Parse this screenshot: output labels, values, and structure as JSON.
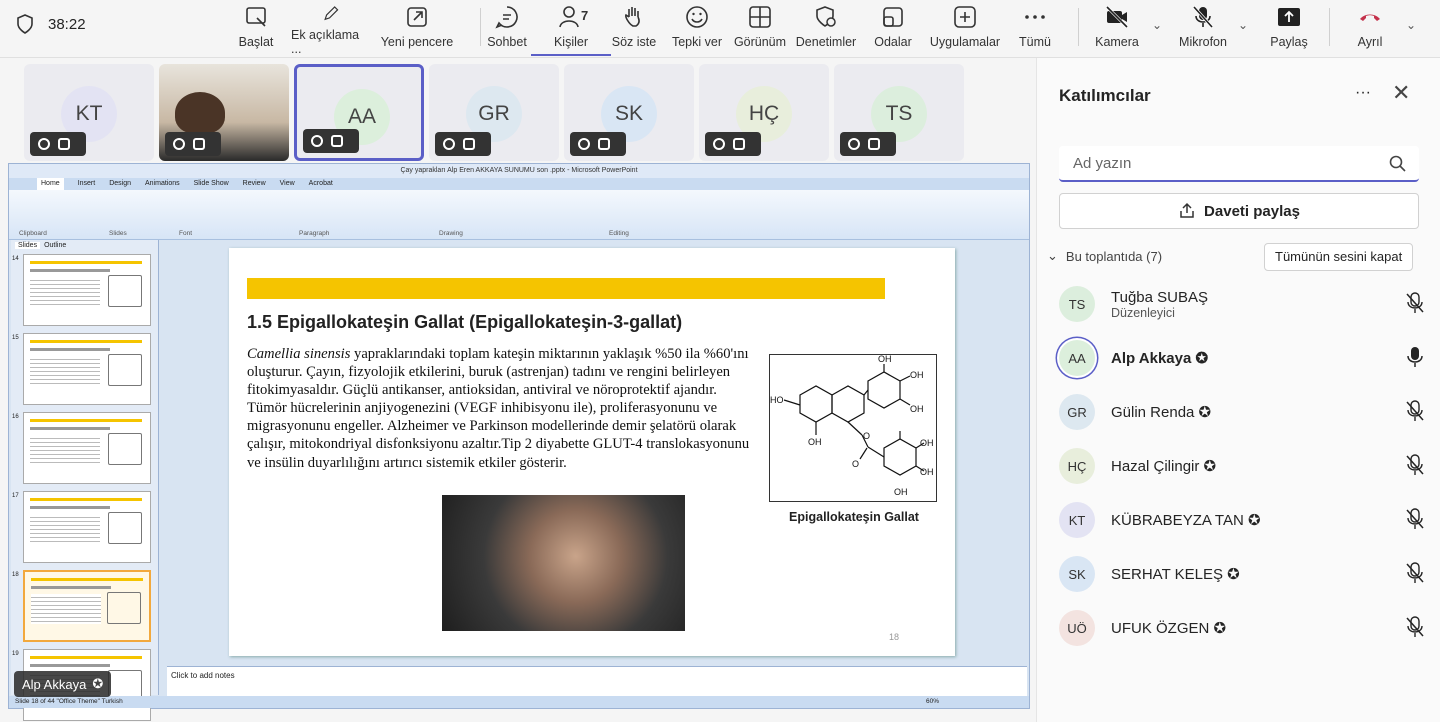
{
  "timer": "38:22",
  "toolbar": [
    {
      "id": "baslat",
      "label": "Başlat",
      "icon": "record-icon"
    },
    {
      "id": "ek",
      "label": "Ek açıklama ...",
      "icon": "pen-icon"
    },
    {
      "id": "yeni",
      "label": "Yeni pencere",
      "icon": "popout-icon"
    },
    {
      "id": "sohbet",
      "label": "Sohbet",
      "icon": "chat-icon"
    },
    {
      "id": "kisiler",
      "label": "Kişiler",
      "icon": "people-icon",
      "count": "7"
    },
    {
      "id": "soz",
      "label": "Söz iste",
      "icon": "hand-icon"
    },
    {
      "id": "tepki",
      "label": "Tepki ver",
      "icon": "emoji-icon"
    },
    {
      "id": "gorunum",
      "label": "Görünüm",
      "icon": "grid-icon"
    },
    {
      "id": "denetim",
      "label": "Denetimler",
      "icon": "shield-gear-icon"
    },
    {
      "id": "odalar",
      "label": "Odalar",
      "icon": "rooms-icon"
    },
    {
      "id": "uyg",
      "label": "Uygulamalar",
      "icon": "plus-icon"
    },
    {
      "id": "tumu",
      "label": "Tümü",
      "icon": "more-icon"
    },
    {
      "id": "kamera",
      "label": "Kamera",
      "icon": "camera-off-icon"
    },
    {
      "id": "mikrofon",
      "label": "Mikrofon",
      "icon": "mic-off-icon"
    },
    {
      "id": "paylas",
      "label": "Paylaş",
      "icon": "share-icon"
    },
    {
      "id": "ayril",
      "label": "Ayrıl",
      "icon": "hangup-icon"
    }
  ],
  "tiles": [
    {
      "initials": "KT",
      "bg": "#e3e3f3"
    },
    {
      "initials": "",
      "video": true
    },
    {
      "initials": "AA",
      "bg": "#dcefdc",
      "selected": true
    },
    {
      "initials": "GR",
      "bg": "#dde8f0"
    },
    {
      "initials": "SK",
      "bg": "#d9e6f4"
    },
    {
      "initials": "HÇ",
      "bg": "#e8eedc"
    },
    {
      "initials": "TS",
      "bg": "#dceedd"
    }
  ],
  "ppt": {
    "title": "Çay yaprakları Alp Eren AKKAYA SUNUMU son .pptx - Microsoft PowerPoint",
    "tabs": [
      "Home",
      "Insert",
      "Design",
      "Animations",
      "Slide Show",
      "Review",
      "View",
      "Acrobat"
    ],
    "groups": [
      "Clipboard",
      "Slides",
      "Font",
      "Paragraph",
      "Drawing",
      "Editing"
    ],
    "panel_tabs": [
      "Slides",
      "Outline"
    ],
    "thumb_numbers": [
      "14",
      "15",
      "16",
      "17",
      "18",
      "19"
    ],
    "notes": "Click to add notes",
    "status": "Slide 18 of 44   \"Office Theme\"   Turkish",
    "zoom": "60%"
  },
  "slide": {
    "title": "1.5 Epigallokateşin Gallat (Epigallokateşin-3-gallat)",
    "body_italic": "Camellia sinensis",
    "body": " yapraklarındaki toplam kateşin miktarının yaklaşık %50 ila %60'ını oluşturur. Çayın, fizyolojik etkilerini, buruk (astrenjan) tadını ve rengini belirleyen fitokimyasaldır. Güçlü antikanser, antioksidan, antiviral ve nöroprotektif ajandır. Tümör hücrelerinin anjiyogenezini (VEGF inhibisyonu ile), proliferasyonunu ve migrasyonunu engeller. Alzheimer ve Parkinson modellerinde demir şelatörü olarak çalışır, mitokondriyal disfonksiyonu azaltır.Tip 2 diyabette GLUT-4 translokasyonunu ve insülin duyarlılığını artırıcı sistemik etkiler gösterir.",
    "caption": "Epigallokateşin Gallat",
    "page": "18",
    "oh": "OH",
    "ho": "HO",
    "o": "O"
  },
  "presenter": "Alp Akkaya",
  "panel": {
    "title": "Katılımcılar",
    "search_placeholder": "Ad yazın",
    "invite": "Daveti paylaş",
    "in_meeting": "Bu toplantıda (7)",
    "mute_all": "Tümünün sesini kapat",
    "people": [
      {
        "initials": "TS",
        "name": "Tuğba SUBAŞ",
        "role": "Düzenleyici",
        "bg": "#dceedd",
        "mic": "off"
      },
      {
        "initials": "AA",
        "name": "Alp Akkaya",
        "bg": "#dcefdc",
        "mic": "on",
        "bold": true,
        "ring": true
      },
      {
        "initials": "GR",
        "name": "Gülin Renda",
        "bg": "#dde8f0",
        "mic": "off"
      },
      {
        "initials": "HÇ",
        "name": "Hazal Çilingir",
        "bg": "#e8eedc",
        "mic": "off"
      },
      {
        "initials": "KT",
        "name": "KÜBRABEYZA TAN",
        "bg": "#e3e3f3",
        "mic": "off"
      },
      {
        "initials": "SK",
        "name": "SERHAT KELEŞ",
        "bg": "#d9e6f4",
        "mic": "off"
      },
      {
        "initials": "UÖ",
        "name": "UFUK ÖZGEN",
        "bg": "#f3e3e0",
        "mic": "off"
      }
    ]
  }
}
